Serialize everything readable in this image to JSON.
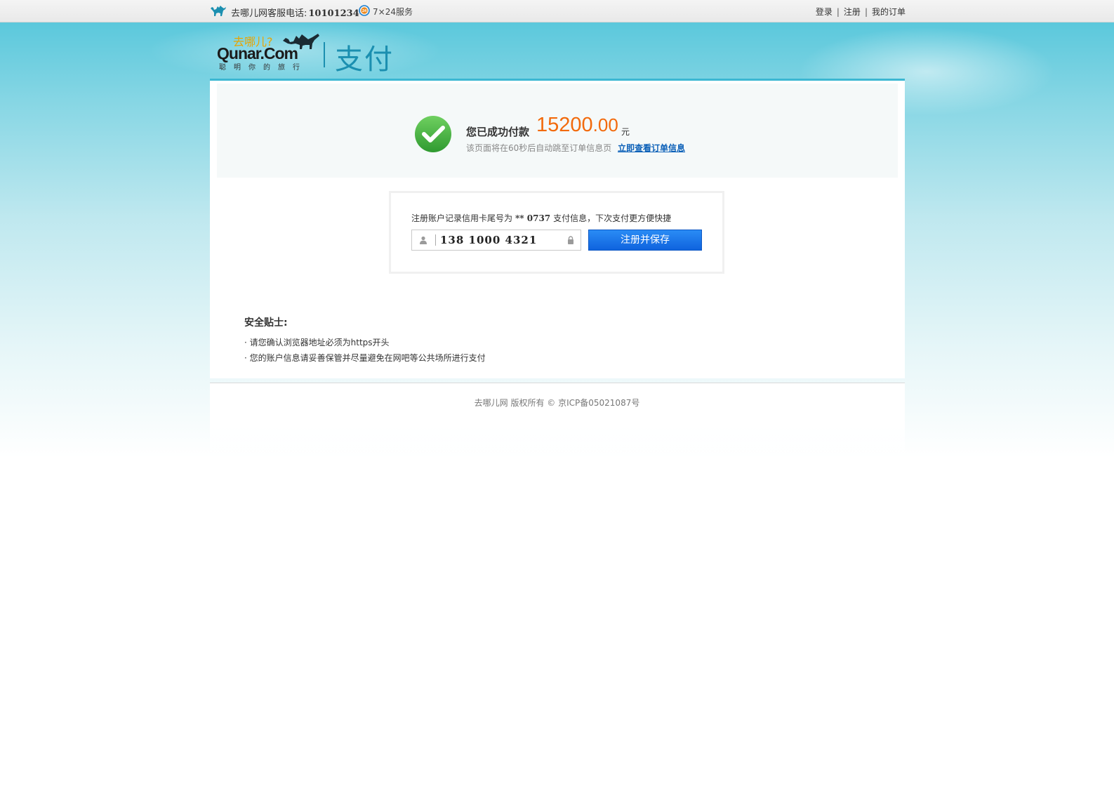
{
  "topbar": {
    "phone_label": "去哪儿网客服电话:",
    "phone_number": "10101234",
    "service_label": "7×24服务",
    "links": {
      "login": "登录",
      "register": "注册",
      "my_orders": "我的订单"
    }
  },
  "logo": {
    "cn_name": "去哪儿?",
    "en_name": "Qunar.Com",
    "slogan": "聪明你的旅行",
    "section_title": "支付"
  },
  "success": {
    "paid_text": "您已成功付款",
    "amount_int": "15200",
    "amount_dec": ".00",
    "unit": "元",
    "redirect_text": "该页面将在60秒后自动跳至订单信息页",
    "view_order_link": "立即查看订单信息"
  },
  "register": {
    "text_before": "注册账户记录信用卡尾号为",
    "card_tail": "** 0737",
    "text_after": "支付信息，下次支付更方便快捷",
    "phone_value": "138 1000 4321",
    "button_label": "注册并保存"
  },
  "tips": {
    "title": "安全贴士:",
    "items": [
      "· 请您确认浏览器地址必须为https开头",
      "· 您的账户信息请妥善保管并尽量避免在网吧等公共场所进行支付"
    ]
  },
  "footer": {
    "copyright": "去哪儿网 版权所有 © 京ICP备05021087号"
  },
  "colors": {
    "accent": "#1b8fb0",
    "amount": "#f26a0c",
    "button": "#1570e8",
    "link": "#0b60b8",
    "success_green": "#3db040"
  }
}
